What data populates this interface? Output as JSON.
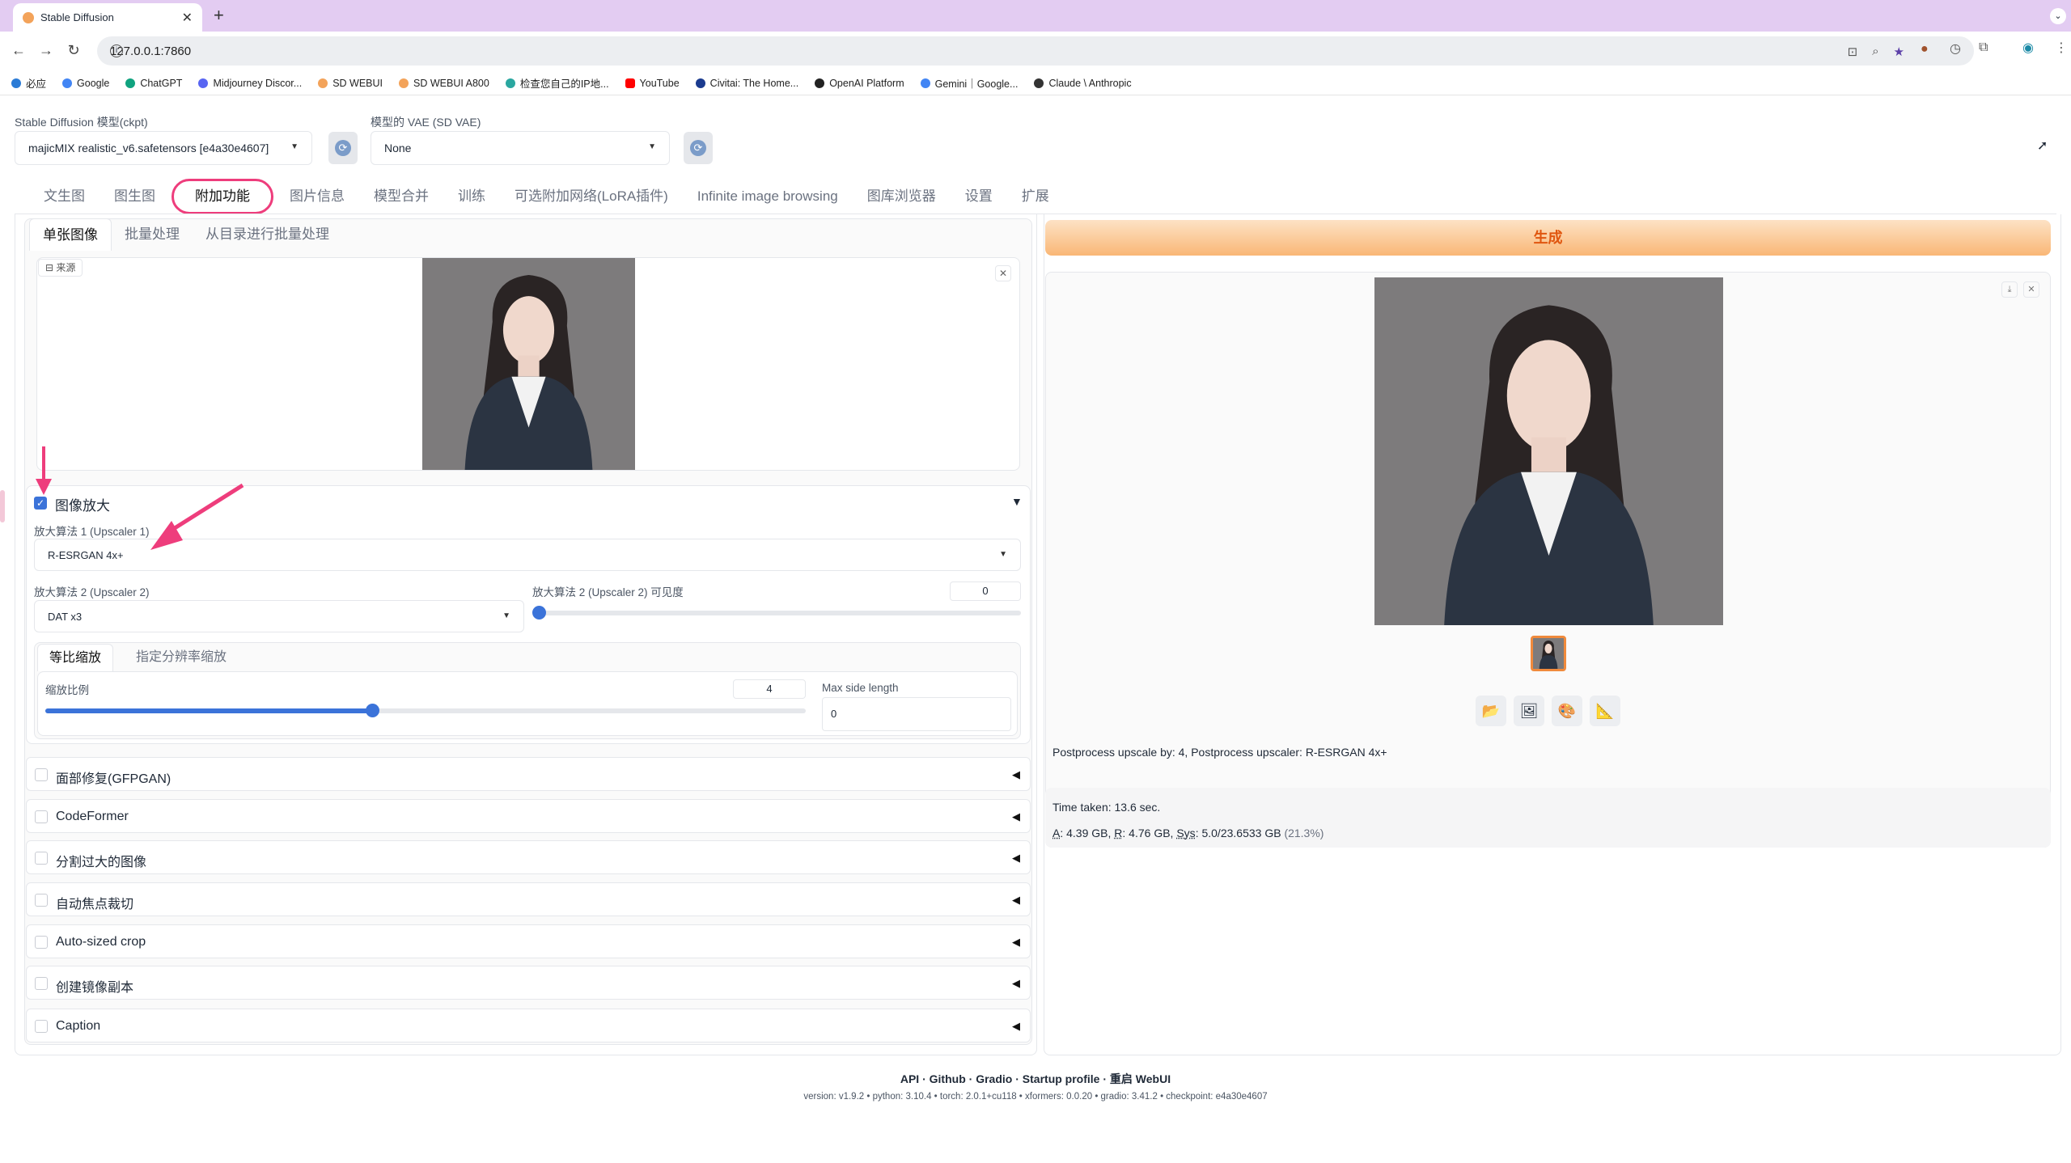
{
  "browser": {
    "tab_title": "Stable Diffusion",
    "url": "127.0.0.1:7860",
    "bookmarks": [
      "必应",
      "Google",
      "ChatGPT",
      "Midjourney Discor...",
      "SD WEBUI",
      "SD WEBUI A800",
      "检查您自己的IP地...",
      "YouTube",
      "Civitai: The Home...",
      "OpenAI Platform",
      "Gemini｜Google...",
      "Claude \\ Anthropic"
    ]
  },
  "top": {
    "model_label": "Stable Diffusion 模型(ckpt)",
    "model_value": "majicMIX realistic_v6.safetensors [e4a30e4607]",
    "vae_label": "模型的 VAE (SD VAE)",
    "vae_value": "None"
  },
  "main_tabs": [
    "文生图",
    "图生图",
    "附加功能",
    "图片信息",
    "模型合并",
    "训练",
    "可选附加网络(LoRA插件)",
    "Infinite image browsing",
    "图库浏览器",
    "设置",
    "扩展"
  ],
  "sub_tabs": [
    "单张图像",
    "批量处理",
    "从目录进行批量处理"
  ],
  "source": {
    "label": "来源"
  },
  "upscale": {
    "enabled": true,
    "title": "图像放大",
    "upscaler1_label": "放大算法 1 (Upscaler 1)",
    "upscaler1_value": "R-ESRGAN 4x+",
    "upscaler2_label": "放大算法 2 (Upscaler 2)",
    "upscaler2_value": "DAT x3",
    "visibility_label": "放大算法 2 (Upscaler 2) 可见度",
    "visibility_value": "0",
    "visibility_fraction": 0,
    "mode_tabs": [
      "等比缩放",
      "指定分辨率缩放"
    ],
    "scale_label": "缩放比例",
    "scale_value": "4",
    "scale_fraction": 0.43,
    "max_side_label": "Max side length",
    "max_side_value": "0"
  },
  "accordions": [
    "面部修复(GFPGAN)",
    "CodeFormer",
    "分割过大的图像",
    "自动焦点裁切",
    "Auto-sized crop",
    "创建镜像副本",
    "Caption"
  ],
  "generate_label": "生成",
  "output": {
    "info_line": "Postprocess upscale by: 4, Postprocess upscaler: R-ESRGAN 4x+",
    "time_taken": "Time taken: 13.6 sec.",
    "mem_A_label": "A",
    "mem_A": ": 4.39 GB, ",
    "mem_R_label": "R",
    "mem_R": ": 4.76 GB, ",
    "mem_Sys_label": "Sys",
    "mem_Sys": ": 5.0/23.6533 GB ",
    "mem_pct": "(21.3%)"
  },
  "footer": {
    "links": [
      "API",
      "Github",
      "Gradio",
      "Startup profile",
      "重启 WebUI"
    ],
    "version": "version: v1.9.2  •  python: 3.10.4  •  torch: 2.0.1+cu118  •  xformers: 0.0.20  •  gradio: 3.41.2  •  checkpoint: e4a30e4607"
  },
  "colors": {
    "accent": "#3b73d9",
    "highlight": "#ee3d7c",
    "generate_text": "#e0560f",
    "tabbar": "#e3ccf2"
  },
  "icons": [
    "folder-icon",
    "image-icon",
    "palette-icon",
    "ruler-icon"
  ]
}
